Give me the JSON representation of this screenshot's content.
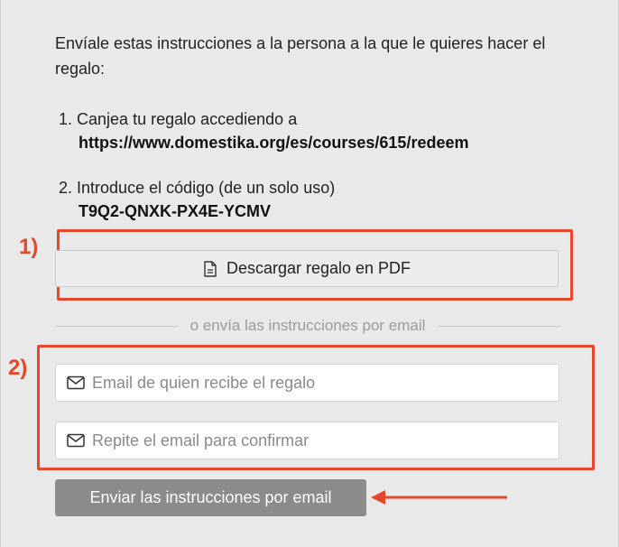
{
  "intro": "Envíale estas instrucciones a la persona a la que le quieres hacer el regalo:",
  "steps": [
    {
      "number": "1.",
      "text": "Canjea tu regalo accediendo a",
      "detail": "https://www.domestika.org/es/courses/615/redeem"
    },
    {
      "number": "2.",
      "text": "Introduce el código (de un solo uso)",
      "detail": "T9Q2-QNXK-PX4E-YCMV"
    }
  ],
  "annotations": {
    "first": "1)",
    "second": "2)",
    "color": "#e4472b"
  },
  "download_button": {
    "label": "Descargar regalo en PDF",
    "icon": "document-icon"
  },
  "divider_text": "o envía las instrucciones por email",
  "fields": {
    "recipient_email": {
      "placeholder": "Email de quien recibe el regalo",
      "value": "",
      "icon": "envelope-icon"
    },
    "confirm_email": {
      "placeholder": "Repite el email para confirmar",
      "value": "",
      "icon": "envelope-icon"
    }
  },
  "send_button": {
    "label": "Enviar las instrucciones por email",
    "color": "#8b8b8b"
  }
}
